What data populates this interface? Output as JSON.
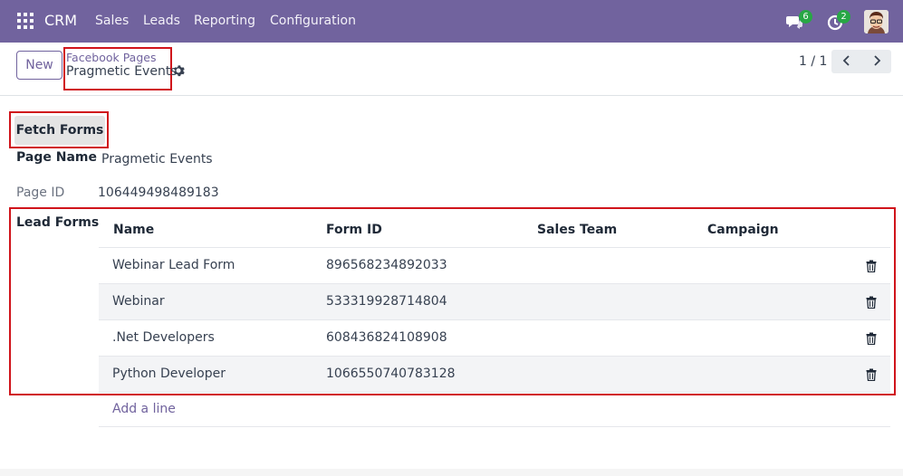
{
  "navbar": {
    "app_name": "CRM",
    "menu": [
      "Sales",
      "Leads",
      "Reporting",
      "Configuration"
    ],
    "messages_count": "6",
    "activities_count": "2",
    "color": "#71639e"
  },
  "control_panel": {
    "new_button": "New",
    "breadcrumb_parent": "Facebook Pages",
    "breadcrumb_current": "Pragmetic Events",
    "pager": "1 / 1"
  },
  "form": {
    "fetch_button": "Fetch Forms",
    "page_name_label": "Page Name",
    "page_name_value": "Pragmetic Events",
    "page_id_label": "Page ID",
    "page_id_value": "106449498489183",
    "lead_forms_label": "Lead Forms"
  },
  "lead_forms": {
    "columns": [
      "Name",
      "Form ID",
      "Sales Team",
      "Campaign"
    ],
    "rows": [
      {
        "name": "Webinar Lead Form",
        "form_id": "896568234892033",
        "sales_team": "",
        "campaign": ""
      },
      {
        "name": "Webinar",
        "form_id": "533319928714804",
        "sales_team": "",
        "campaign": ""
      },
      {
        "name": ".Net Developers",
        "form_id": "608436824108908",
        "sales_team": "",
        "campaign": ""
      },
      {
        "name": "Python Developer",
        "form_id": "1066550740783128",
        "sales_team": "",
        "campaign": ""
      }
    ],
    "add_line": "Add a line"
  },
  "icons": {
    "apps": "apps-grid-icon",
    "messages": "chat-icon",
    "activities": "clock-icon",
    "settings": "gear-icon",
    "delete": "trash-icon",
    "prev": "chevron-left-icon",
    "next": "chevron-right-icon"
  }
}
